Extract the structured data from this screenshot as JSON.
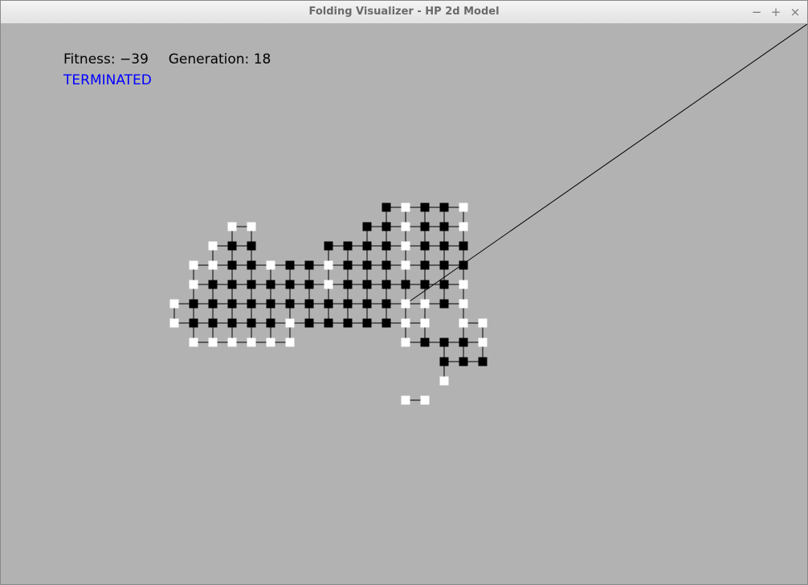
{
  "window": {
    "title": "Folding Visualizer - HP 2d Model",
    "controls": {
      "minimize": "−",
      "maximize": "+",
      "close": "×"
    }
  },
  "hud": {
    "fitness_label": "Fitness:",
    "fitness_value": "−39",
    "generation_label": "Generation:",
    "generation_value": "18",
    "status": "TERMINATED",
    "status_color": "#0000ff"
  },
  "colors": {
    "background": "#b2b2b2",
    "hydrophobic": "#000000",
    "polar": "#ffffff",
    "bond": "#000000"
  },
  "legend_semantics": {
    "H": "hydrophobic residue (black)",
    "P": "polar residue (white)"
  },
  "chain": {
    "lattice_cells": [
      [
        0,
        5,
        "P"
      ],
      [
        1,
        5,
        "P"
      ],
      [
        2,
        4,
        "P"
      ],
      [
        2,
        3,
        "H"
      ],
      [
        3,
        3,
        "H"
      ],
      [
        4,
        3,
        "H"
      ],
      [
        4,
        2,
        "P"
      ],
      [
        4,
        1,
        "P"
      ],
      [
        3,
        1,
        "P"
      ],
      [
        3,
        2,
        "H"
      ],
      [
        2,
        2,
        "H"
      ],
      [
        1,
        2,
        "H"
      ],
      [
        1,
        1,
        "P"
      ],
      [
        0,
        1,
        "P"
      ],
      [
        0,
        0,
        "P"
      ],
      [
        1,
        0,
        "P"
      ],
      [
        1,
        -1,
        "H"
      ],
      [
        1,
        -2,
        "H"
      ],
      [
        0,
        -2,
        "P"
      ],
      [
        0,
        -3,
        "P"
      ],
      [
        0,
        -4,
        "P"
      ],
      [
        -1,
        -4,
        "H"
      ],
      [
        -1,
        -3,
        "H"
      ],
      [
        -1,
        -2,
        "H"
      ],
      [
        -1,
        -1,
        "H"
      ],
      [
        -1,
        0,
        "H"
      ],
      [
        -2,
        0,
        "H"
      ],
      [
        -2,
        -1,
        "H"
      ],
      [
        -2,
        -2,
        "H"
      ],
      [
        -2,
        -3,
        "H"
      ],
      [
        -3,
        -3,
        "H"
      ],
      [
        -3,
        -2,
        "H"
      ],
      [
        -3,
        -1,
        "H"
      ],
      [
        -3,
        0,
        "H"
      ],
      [
        -3,
        1,
        "H"
      ],
      [
        -2,
        1,
        "H"
      ],
      [
        -1,
        1,
        "H"
      ],
      [
        0,
        -5,
        "P"
      ],
      [
        1,
        -5,
        "H"
      ],
      [
        2,
        -5,
        "H"
      ],
      [
        3,
        -5,
        "P"
      ],
      [
        3,
        -4,
        "P"
      ],
      [
        3,
        -3,
        "H"
      ],
      [
        3,
        -2,
        "H"
      ],
      [
        2,
        -2,
        "H"
      ],
      [
        2,
        -1,
        "H"
      ],
      [
        2,
        0,
        "H"
      ],
      [
        3,
        0,
        "P"
      ],
      [
        3,
        -1,
        "P"
      ],
      [
        -4,
        -2,
        "P"
      ],
      [
        -4,
        -1,
        "P"
      ],
      [
        -5,
        -1,
        "H"
      ],
      [
        -5,
        0,
        "H"
      ],
      [
        -4,
        0,
        "H"
      ],
      [
        -4,
        1,
        "H"
      ],
      [
        -5,
        1,
        "H"
      ],
      [
        -6,
        1,
        "P"
      ],
      [
        -6,
        2,
        "P"
      ],
      [
        -7,
        2,
        "P"
      ],
      [
        -7,
        1,
        "H"
      ],
      [
        -8,
        1,
        "H"
      ],
      [
        -8,
        2,
        "P"
      ],
      [
        -9,
        2,
        "P"
      ],
      [
        -9,
        1,
        "H"
      ],
      [
        -9,
        0,
        "H"
      ],
      [
        -8,
        0,
        "H"
      ],
      [
        -7,
        0,
        "H"
      ],
      [
        -6,
        0,
        "H"
      ],
      [
        -6,
        -1,
        "H"
      ],
      [
        -6,
        -2,
        "H"
      ],
      [
        -7,
        -2,
        "P"
      ],
      [
        -7,
        -1,
        "H"
      ],
      [
        -8,
        -1,
        "H"
      ],
      [
        -8,
        -2,
        "H"
      ],
      [
        -9,
        -2,
        "H"
      ],
      [
        -9,
        -1,
        "H"
      ],
      [
        -10,
        -1,
        "H"
      ],
      [
        -10,
        0,
        "H"
      ],
      [
        -10,
        1,
        "H"
      ],
      [
        -10,
        2,
        "P"
      ],
      [
        -11,
        2,
        "P"
      ],
      [
        -11,
        1,
        "H"
      ],
      [
        -11,
        0,
        "H"
      ],
      [
        -11,
        -1,
        "P"
      ],
      [
        -10,
        -2,
        "P"
      ],
      [
        -9,
        -3,
        "H"
      ],
      [
        -8,
        -3,
        "H"
      ],
      [
        -9,
        -4,
        "P"
      ],
      [
        -8,
        -4,
        "P"
      ],
      [
        -5,
        -2,
        "H"
      ],
      [
        -4,
        -3,
        "H"
      ],
      [
        -2,
        -4,
        "H"
      ],
      [
        -1,
        -5,
        "H"
      ],
      [
        1,
        -3,
        "H"
      ],
      [
        1,
        -4,
        "H"
      ],
      [
        2,
        -4,
        "H"
      ],
      [
        2,
        -3,
        "H"
      ],
      [
        0,
        -1,
        "H"
      ],
      [
        0,
        2,
        "P"
      ],
      [
        3,
        1,
        "P"
      ],
      [
        -12,
        0,
        "P"
      ],
      [
        -12,
        1,
        "P"
      ],
      [
        -11,
        -2,
        "P"
      ],
      [
        -10,
        -3,
        "P"
      ]
    ]
  }
}
